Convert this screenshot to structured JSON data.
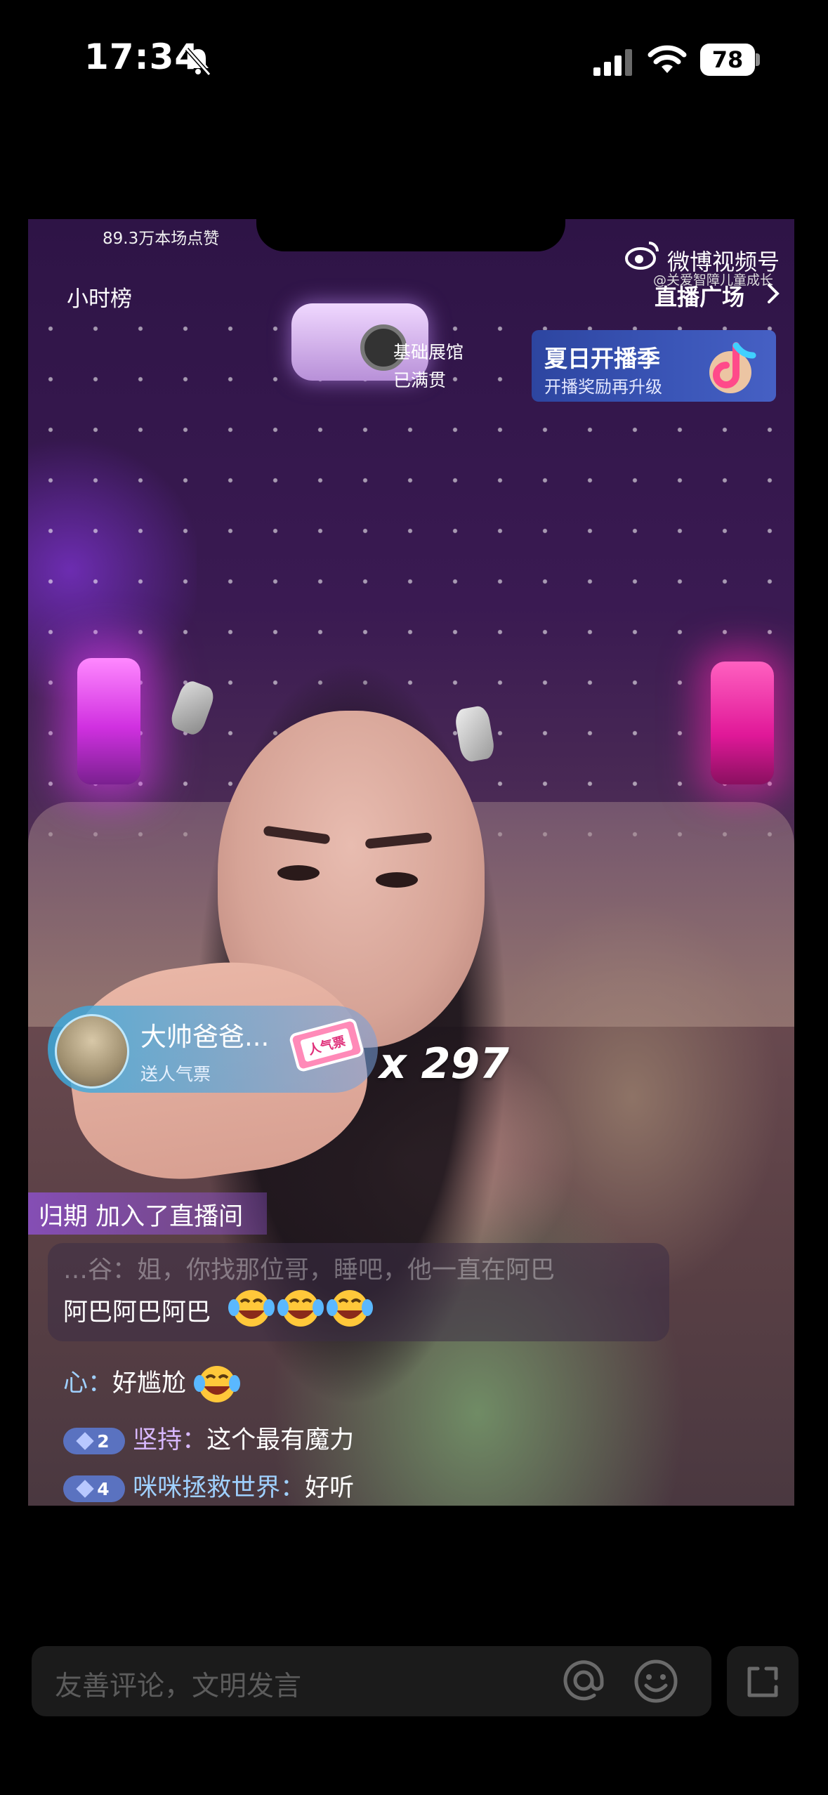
{
  "status_bar": {
    "time": "17:34",
    "battery": "78",
    "icons": [
      "bell-slash-icon",
      "signal-icon",
      "wifi-icon",
      "battery-icon"
    ]
  },
  "live_top": {
    "likes": "89.3万本场点赞",
    "hour_rank": "小时榜",
    "weibo_label": "微博视频号",
    "weibo_handle": "@关爱智障儿童成长",
    "live_square": "直播广场"
  },
  "scene_sign": {
    "line1": "基础展馆",
    "line2": "已满贯"
  },
  "promo": {
    "title": "夏日开播季",
    "subtitle": "开播奖励再升级"
  },
  "gift": {
    "sender": "大帅爸爸...",
    "action": "送人气票",
    "ticket_label": "人气票",
    "count": "x 297"
  },
  "chat": {
    "join_message": "归期 加入了直播间",
    "faded_message": "…谷：姐，你找那位哥，睡吧，他一直在阿巴",
    "messages": [
      {
        "text": "阿巴阿巴阿巴",
        "emoji_count": 3
      },
      {
        "user": "心",
        "sep": "：",
        "text": "好尴尬",
        "emoji_count": 1
      },
      {
        "level": "2",
        "user": "坚持",
        "sep": "：",
        "text": "这个最有魔力"
      },
      {
        "level": "4",
        "user": "咪咪拯救世界",
        "sep": "：",
        "text": "好听"
      }
    ]
  },
  "bottom_bar": {
    "comment_placeholder": "友善评论，文明发言",
    "icons": [
      "at-icon",
      "emoji-icon",
      "expand-icon"
    ]
  },
  "colors": {
    "promo_bg": "#3b56b8",
    "gift_pill": "#3caadc",
    "level_badge": "#5a72c0",
    "join_banner": "#8c50c8"
  }
}
